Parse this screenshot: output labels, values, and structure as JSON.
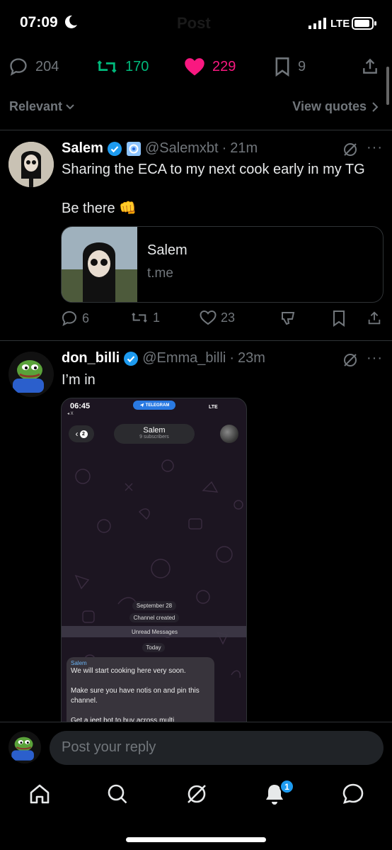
{
  "status": {
    "time": "07:09",
    "network": "LTE",
    "header_ghost": "Post"
  },
  "engagement": {
    "replies": "204",
    "reposts": "170",
    "likes": "229",
    "bookmarks": "9"
  },
  "sort": {
    "relevant": "Relevant",
    "view_quotes": "View quotes"
  },
  "posts": [
    {
      "name": "Salem",
      "handle": "@Salemxbt",
      "time": "21m",
      "lines": [
        "Sharing the ECA to my next cook early in my TG",
        "Be there 👊"
      ],
      "card": {
        "title": "Salem",
        "domain": "t.me"
      },
      "actions": {
        "replies": "6",
        "reposts": "1",
        "likes": "23"
      }
    },
    {
      "name": "don_billi",
      "handle": "@Emma_billi",
      "time": "23m",
      "lines": [
        "I’m in"
      ],
      "embed": {
        "time": "06:45",
        "back_app": "◂ X",
        "app_pill": "TELEGRAM",
        "network": "LTE",
        "back_count": "2",
        "channel_title": "Salem",
        "channel_sub": "9 subscribers",
        "date_pill": "September 28",
        "created_pill": "Channel created",
        "unread": "Unread Messages",
        "today_pill": "Today",
        "msg_from": "Salem",
        "msg_text": "We will start cooking here very soon.\n\nMake sure you have notis on and pin this channel.\n\nGet a jeet bot to buy across multi"
      }
    }
  ],
  "reply": {
    "placeholder": "Post your reply"
  },
  "tabbar": {
    "notifications_count": "1"
  },
  "colors": {
    "accent": "#1d9bf0",
    "like": "#f91880",
    "repost": "#00ba7c",
    "muted": "#71767b"
  }
}
